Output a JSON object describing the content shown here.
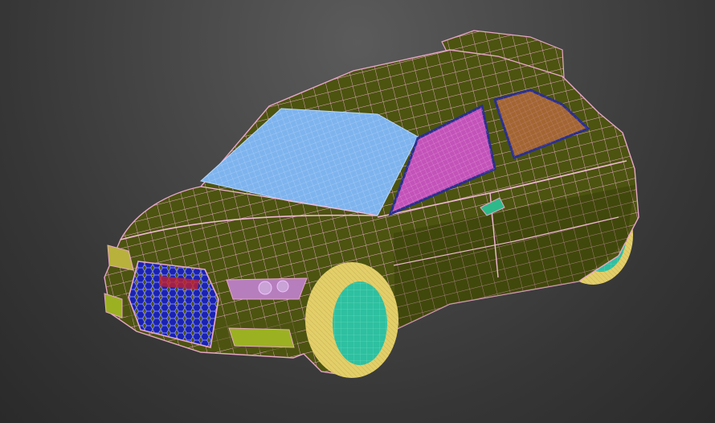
{
  "viewport": {
    "view": "perspective",
    "display_mode": "wireframe-over-shaded",
    "background_colors": [
      "#5b5b5b",
      "#2a2a2a"
    ]
  },
  "model": {
    "object": "hatchback-car",
    "badge_text": "",
    "colors": {
      "body": "#4c5410",
      "body_dark": "#3d4508",
      "wire": "#e8a6c8",
      "windshield": "#7eb4ee",
      "front_side_window": "#c353b9",
      "rear_side_window": "#a36632",
      "window_frame": "#2a2f8f",
      "grille": "#2430c8",
      "grille_mesh": "#5c67ff",
      "headlight": "#b67ebc",
      "fog_lamp": "#9cb122",
      "tire": "#e3cf6a",
      "rim": "#2ec0a0",
      "mirror_logo": "#2eb98a"
    },
    "icons": [
      "car-body-mesh",
      "windshield",
      "side-window",
      "rear-window",
      "front-grille",
      "headlight",
      "fog-lamp",
      "front-wheel",
      "rear-wheel",
      "side-mirror"
    ]
  }
}
